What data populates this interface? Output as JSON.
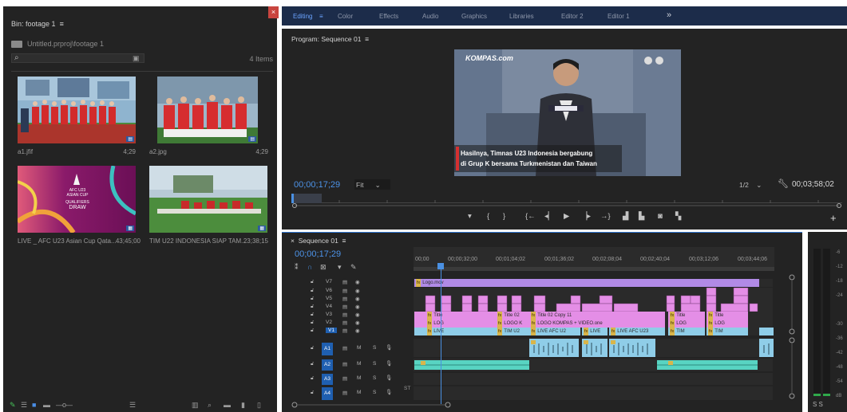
{
  "bin": {
    "title": "Bin: footage 1",
    "path": "Untitled.prproj\\footage 1",
    "close_label": "×",
    "item_count": "4 Items",
    "items": [
      {
        "name": "a1.jfif",
        "duration": "4;29"
      },
      {
        "name": "a2.jpg",
        "duration": "4;29"
      },
      {
        "name": "LIVE _ AFC U23 Asian Cup Qata...",
        "duration": "43;45;00"
      },
      {
        "name": "TIM U22 INDONESIA SIAP TAM...",
        "duration": "23;38;15"
      }
    ],
    "afc_overlay": {
      "line1": "AFC U23",
      "line2": "ASIAN CUP",
      "line3": "QUALIFIERS",
      "line4": "DRAW"
    }
  },
  "workspace_tabs": [
    {
      "label": "Editing",
      "active": true
    },
    {
      "label": "Color"
    },
    {
      "label": "Effects"
    },
    {
      "label": "Audio"
    },
    {
      "label": "Graphics"
    },
    {
      "label": "Libraries"
    },
    {
      "label": "Editor 2"
    },
    {
      "label": "Editor 1"
    },
    {
      "label": "»"
    }
  ],
  "program": {
    "title": "Program: Sequence 01",
    "timecode": "00;00;17;29",
    "fit": "Fit",
    "resolution": "1/2",
    "duration": "00;03;58;02",
    "video": {
      "brand": "KOMPAS.com",
      "caption_line1": "Hasilnya, Timnas U23 Indonesia bergabung",
      "caption_line2": "di Grup K bersama Turkmenistan dan Taiwan"
    }
  },
  "sequence": {
    "title": "Sequence 01",
    "timecode": "00;00;17;29",
    "ruler": [
      "00;00",
      "00;00;32;00",
      "00;01;04;02",
      "00;01;36;02",
      "00;02;08;04",
      "00;02;40;04",
      "00;03;12;06",
      "00;03;44;06"
    ],
    "video_tracks": [
      "V7",
      "V6",
      "V5",
      "V4",
      "V3",
      "V2",
      "V1"
    ],
    "audio_tracks": [
      "A1",
      "A2",
      "A3",
      "A4"
    ],
    "audio_ms": [
      "M",
      "S"
    ],
    "extra_track_label": "ST",
    "clips": {
      "v7": "Logo.mov",
      "v3a": "Title",
      "v3b": "Title 02",
      "v3c": "Title 02 Copy 11",
      "v3d": "Title",
      "v3e": "Title",
      "v2a": "LOG",
      "v2b": "LOGO K",
      "v2c": "LOGO KOMPAS + VIDEO.one",
      "v2d": "LOG",
      "v2e": "LOG",
      "v1a": "LIVE",
      "v1b": "TIM U2",
      "v1c": "LIVE  AFC U2",
      "v1d": "LIVE",
      "v1e": "LIVE  AFC U23",
      "v1f": "TIM",
      "v1g": "TIM"
    }
  },
  "meter": {
    "ticks": [
      "-6",
      "-12",
      "-18",
      "-24",
      "-30",
      "-36",
      "-42",
      "-48",
      "-54",
      "dB"
    ],
    "solo_label": "S  S"
  },
  "colors": {
    "accent": "#4d93e8",
    "video_clip": "#e48ee6",
    "logo_clip": "#b18ae6",
    "v1_clip": "#8fcde8",
    "audio_clip": "#58d4c2"
  }
}
